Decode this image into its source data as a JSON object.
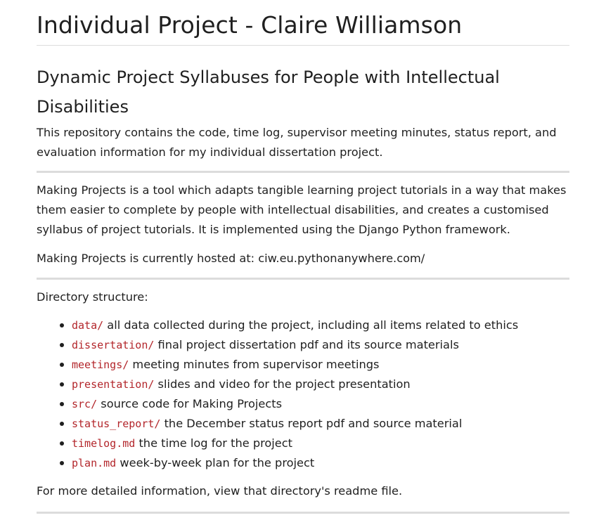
{
  "title": "Individual Project - Claire Williamson",
  "subtitle": "Dynamic Project Syllabuses for People with Intellectual Disabilities",
  "intro": "This repository contains the code, time log, supervisor meeting minutes, status report, and evaluation information for my individual dissertation project.",
  "description": "Making Projects is a tool which adapts tangible learning project tutorials in a way that makes them easier to complete by people with intellectual disabilities, and creates a customised syllabus of project tutorials. It is implemented using the Django Python framework.",
  "hosted": "Making Projects is currently hosted at: ciw.eu.pythonanywhere.com/",
  "directory_heading": "Directory structure:",
  "directories": [
    {
      "name": "data/",
      "desc": " all data collected during the project, including all items related to ethics"
    },
    {
      "name": "dissertation/",
      "desc": " final project dissertation pdf and its source materials"
    },
    {
      "name": "meetings/",
      "desc": " meeting minutes from supervisor meetings"
    },
    {
      "name": "presentation/",
      "desc": " slides and video for the project presentation"
    },
    {
      "name": "src/",
      "desc": " source code for Making Projects"
    },
    {
      "name": "status_report/",
      "desc": " the December status report pdf and source material"
    },
    {
      "name": "timelog.md",
      "desc": " the time log for the project"
    },
    {
      "name": "plan.md",
      "desc": " week-by-week plan for the project"
    }
  ],
  "footer_note": "For more detailed information, view that directory's readme file."
}
